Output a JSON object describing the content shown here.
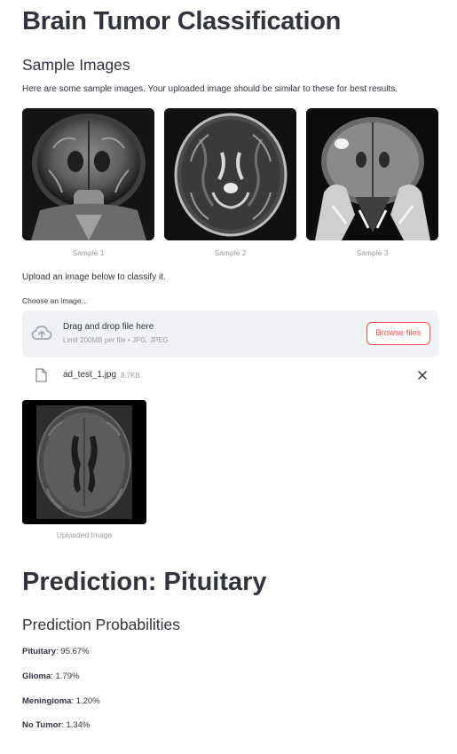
{
  "page": {
    "title": "Brain Tumor Classification"
  },
  "samples_section": {
    "heading": "Sample Images",
    "description": "Here are some sample images. Your uploaded image should be similar to these for best results.",
    "images": [
      {
        "caption": "Sample 1",
        "icon": "mri-coronal-image"
      },
      {
        "caption": "Sample 2",
        "icon": "mri-axial-image"
      },
      {
        "caption": "Sample 3",
        "icon": "mri-coronal-contrast-image"
      }
    ]
  },
  "upload_section": {
    "instruction": "Upload an image below to classify it.",
    "label": "Choose an image...",
    "dropzone_title": "Drag and drop file here",
    "dropzone_limit": "Limit 200MB per file • JPG, JPEG",
    "browse_label": "Browse files",
    "file": {
      "name": "ad_test_1.jpg",
      "size": "8.7KB"
    },
    "uploaded_caption": "Uploaded Image"
  },
  "prediction": {
    "heading": "Prediction: Pituitary",
    "probabilities_heading": "Prediction Probabilities",
    "items": [
      {
        "label": "Pituitary",
        "value": "95.67%"
      },
      {
        "label": "Glioma",
        "value": "1.79%"
      },
      {
        "label": "Meningioma",
        "value": "1.20%"
      },
      {
        "label": "No Tumor",
        "value": "1.34%"
      }
    ]
  },
  "colors": {
    "accent": "#ff4b4b",
    "text": "#31333f",
    "muted": "#9a9ca3",
    "dropzone_bg": "#f0f2f6"
  }
}
